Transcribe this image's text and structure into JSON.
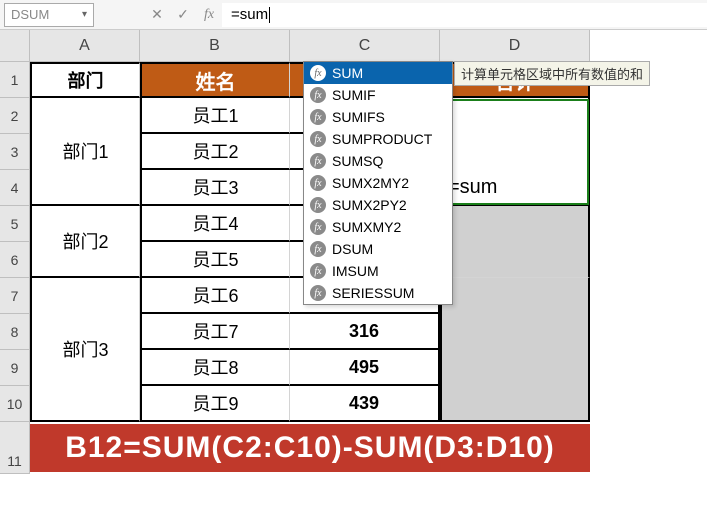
{
  "name_box": "DSUM",
  "formula_input": "=sum",
  "tooltip": "计算单元格区域中所有数值的和",
  "autocomplete": [
    "SUM",
    "SUMIF",
    "SUMIFS",
    "SUMPRODUCT",
    "SUMSQ",
    "SUMX2MY2",
    "SUMX2PY2",
    "SUMXMY2",
    "DSUM",
    "IMSUM",
    "SERIESSUM"
  ],
  "columns": [
    "A",
    "B",
    "C",
    "D"
  ],
  "col_widths": {
    "A": 110,
    "B": 150,
    "C": 150,
    "D": 150
  },
  "row_headers": [
    "1",
    "2",
    "3",
    "4",
    "5",
    "6",
    "7",
    "8",
    "9",
    "10",
    "11"
  ],
  "header_row": {
    "A": "部门",
    "B": "姓名",
    "D": "合计"
  },
  "depts": [
    {
      "name": "部门1",
      "span": 3
    },
    {
      "name": "部门2",
      "span": 2
    },
    {
      "name": "部门3",
      "span": 4
    }
  ],
  "employees": [
    "员工1",
    "员工2",
    "员工3",
    "员工4",
    "员工5",
    "员工6",
    "员工7",
    "员工8",
    "员工9"
  ],
  "col_c_visible": {
    "7": "316",
    "8": "495",
    "9": "439"
  },
  "d4_value": "=sum",
  "bottom_formula": "B12=SUM(C2:C10)-SUM(D3:D10)",
  "chart_data": {
    "type": "table",
    "columns": [
      "部门",
      "姓名",
      "合计"
    ],
    "rows": [
      [
        "部门1",
        "员工1",
        ""
      ],
      [
        "部门1",
        "员工2",
        ""
      ],
      [
        "部门1",
        "员工3",
        "=sum"
      ],
      [
        "部门2",
        "员工4",
        ""
      ],
      [
        "部门2",
        "员工5",
        ""
      ],
      [
        "部门3",
        "员工6",
        ""
      ],
      [
        "部门3",
        "员工7",
        ""
      ],
      [
        "部门3",
        "员工8",
        ""
      ],
      [
        "部门3",
        "员工9",
        ""
      ]
    ],
    "visible_c_values": {
      "员工7": 316,
      "员工8": 495,
      "员工9": 439
    },
    "note_formula": "B12=SUM(C2:C10)-SUM(D3:D10)"
  }
}
